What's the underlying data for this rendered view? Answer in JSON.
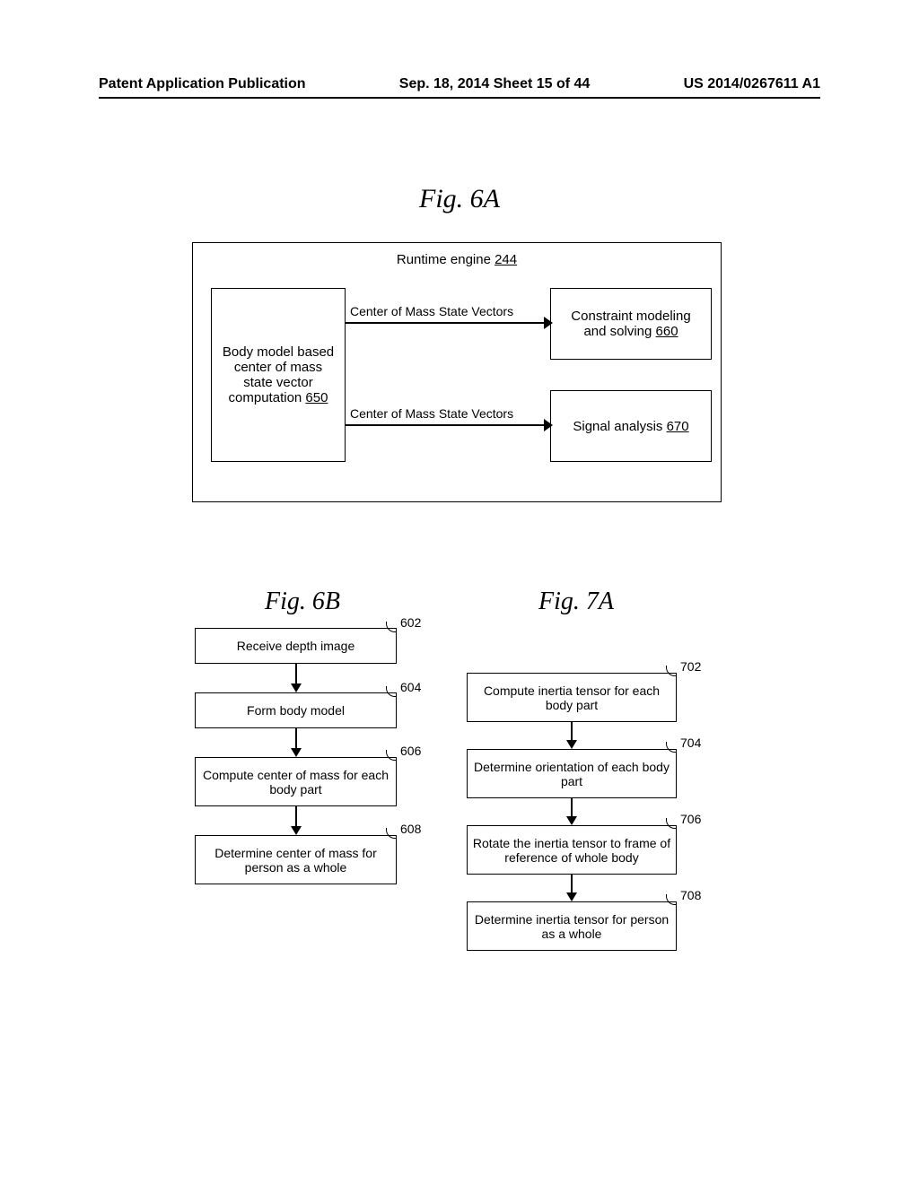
{
  "header": {
    "left": "Patent Application Publication",
    "center": "Sep. 18, 2014  Sheet 15 of 44",
    "right": "US 2014/0267611 A1"
  },
  "fig6a": {
    "title": "Fig. 6A",
    "runtime_label": "Runtime engine ",
    "runtime_num": "244",
    "box650": {
      "text": "Body model based center of mass state vector computation ",
      "num": "650"
    },
    "box660": {
      "text": "Constraint modeling and solving ",
      "num": "660"
    },
    "box670": {
      "text": "Signal analysis ",
      "num": "670"
    },
    "arrow1_label": "Center of Mass State Vectors",
    "arrow2_label": "Center of Mass State Vectors"
  },
  "fig6b": {
    "title": "Fig. 6B",
    "steps": [
      {
        "text": "Receive depth image",
        "ref": "602"
      },
      {
        "text": "Form body model",
        "ref": "604"
      },
      {
        "text": "Compute center of mass for each body part",
        "ref": "606"
      },
      {
        "text": "Determine center of mass for person as a whole",
        "ref": "608"
      }
    ]
  },
  "fig7a": {
    "title": "Fig. 7A",
    "steps": [
      {
        "text": "Compute inertia tensor for each body part",
        "ref": "702"
      },
      {
        "text": "Determine orientation of each body part",
        "ref": "704"
      },
      {
        "text": "Rotate the inertia tensor to frame of reference of whole body",
        "ref": "706"
      },
      {
        "text": "Determine inertia tensor for person as a whole",
        "ref": "708"
      }
    ]
  }
}
